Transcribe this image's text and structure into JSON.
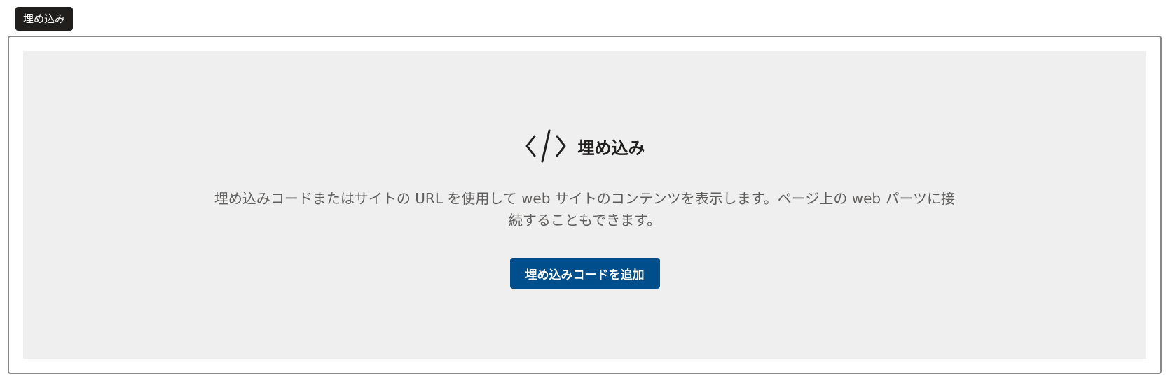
{
  "tag": {
    "label": "埋め込み"
  },
  "placeholder": {
    "icon": "code-icon",
    "title": "埋め込み",
    "description": "埋め込みコードまたはサイトの URL を使用して web サイトのコンテンツを表示します。ページ上の web パーツに接続することもできます。",
    "button_label": "埋め込みコードを追加"
  },
  "colors": {
    "tag_background": "#201f1e",
    "button_background": "#004e8c",
    "placeholder_background": "#efefef",
    "frame_border": "#8a8886",
    "description_text": "#605e5c"
  }
}
